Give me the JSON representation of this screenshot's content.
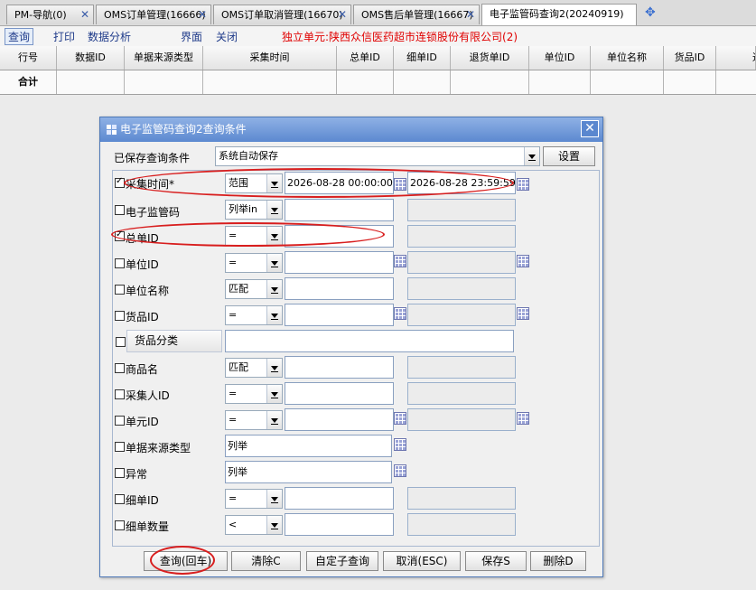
{
  "tabs": [
    {
      "label": "PM-导航(0)",
      "active": false
    },
    {
      "label": "OMS订单管理(16666)",
      "active": false
    },
    {
      "label": "OMS订单取消管理(16670)",
      "active": false
    },
    {
      "label": "OMS售后单管理(16667)",
      "active": false
    },
    {
      "label": "电子监管码查询2(20240919)",
      "active": true
    }
  ],
  "toolbar": {
    "query": "查询",
    "print": "打印",
    "analysis": "数据分析",
    "interface": "界面",
    "close": "关闭",
    "unit": "独立单元:陕西众信医药超市连锁股份有限公司(2)"
  },
  "grid": {
    "columns": [
      "行号",
      "数据ID",
      "单据来源类型",
      "采集时间",
      "总单ID",
      "细单ID",
      "退货单ID",
      "单位ID",
      "单位名称",
      "货品ID",
      "通"
    ],
    "footer_label": "合计"
  },
  "dialog": {
    "title": "电子监管码查询2查询条件",
    "close_glyph": "✕",
    "saved_label": "已保存查询条件",
    "saved_value": "系统自动保存",
    "setup_button": "设置",
    "rows": [
      {
        "checked": true,
        "label": "采集时间*",
        "op": "范围",
        "value1": "2026-08-28 00:00:00",
        "value2": "2026-08-28 23:59:59"
      },
      {
        "checked": false,
        "label": "电子监管码",
        "op": "列举in",
        "value1": "",
        "value2": ""
      },
      {
        "checked": true,
        "label": "总单ID",
        "op": "=",
        "value1": "",
        "value2": ""
      },
      {
        "checked": false,
        "label": "单位ID",
        "op": "=",
        "value1": "",
        "value2": ""
      },
      {
        "checked": false,
        "label": "单位名称",
        "op": "匹配",
        "value1": "",
        "value2": ""
      },
      {
        "checked": false,
        "label": "货品ID",
        "op": "=",
        "value1": "",
        "value2": ""
      },
      {
        "checked": false,
        "label": "货品分类",
        "op": "",
        "value1": "",
        "value2": ""
      },
      {
        "checked": false,
        "label": "商品名",
        "op": "匹配",
        "value1": "",
        "value2": ""
      },
      {
        "checked": false,
        "label": "采集人ID",
        "op": "=",
        "value1": "",
        "value2": ""
      },
      {
        "checked": false,
        "label": "单元ID",
        "op": "=",
        "value1": "",
        "value2": ""
      },
      {
        "checked": false,
        "label": "单据来源类型",
        "op": "列举",
        "value1": "",
        "value2": ""
      },
      {
        "checked": false,
        "label": "异常",
        "op": "列举",
        "value1": "",
        "value2": ""
      },
      {
        "checked": false,
        "label": "细单ID",
        "op": "=",
        "value1": "",
        "value2": ""
      },
      {
        "checked": false,
        "label": "细单数量",
        "op": "<",
        "value1": "",
        "value2": ""
      }
    ],
    "buttons": {
      "query": "查询(回车)",
      "clear": "清除C",
      "subquery": "自定子查询",
      "cancel": "取消(ESC)",
      "save": "保存S",
      "delete": "删除D"
    }
  },
  "colors": {
    "accent": "#5c89d0",
    "highlight": "#d81e1e",
    "unit_text": "#e00000"
  }
}
